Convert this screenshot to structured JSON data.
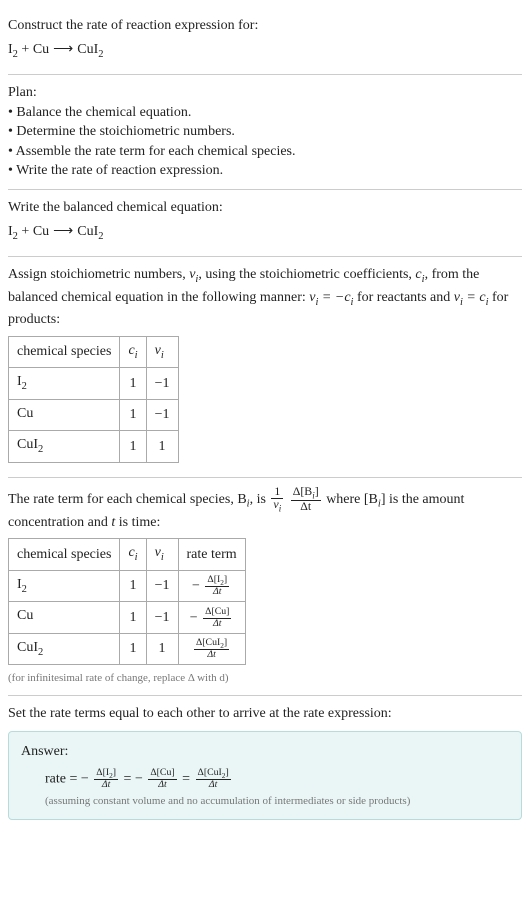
{
  "intro": {
    "prompt": "Construct the rate of reaction expression for:",
    "equation_parts": {
      "r1": "I",
      "r1sub": "2",
      "plus1": " + ",
      "r2": "Cu",
      "arrow": " ⟶ ",
      "p1": "CuI",
      "p1sub": "2"
    }
  },
  "plan": {
    "heading": "Plan:",
    "items": [
      "• Balance the chemical equation.",
      "• Determine the stoichiometric numbers.",
      "• Assemble the rate term for each chemical species.",
      "• Write the rate of reaction expression."
    ]
  },
  "balanced": {
    "heading": "Write the balanced chemical equation:",
    "equation_parts": {
      "r1": "I",
      "r1sub": "2",
      "plus1": " + ",
      "r2": "Cu",
      "arrow": " ⟶ ",
      "p1": "CuI",
      "p1sub": "2"
    }
  },
  "stoich": {
    "text": {
      "a": "Assign stoichiometric numbers, ",
      "nu_i": "ν",
      "nu_i_sub": "i",
      "b": ", using the stoichiometric coefficients, ",
      "c_i": "c",
      "c_i_sub": "i",
      "c": ", from the balanced chemical equation in the following manner: ",
      "eq1_l": "ν",
      "eq1_lsub": "i",
      "eq1_m": " = −c",
      "eq1_msub": "i",
      "d": " for reactants and ",
      "eq2_l": "ν",
      "eq2_lsub": "i",
      "eq2_m": " = c",
      "eq2_msub": "i",
      "e": " for products:"
    },
    "table": {
      "h1": "chemical species",
      "h2": "c",
      "h2sub": "i",
      "h3": "ν",
      "h3sub": "i",
      "rows": [
        {
          "sp": "I",
          "spsub": "2",
          "c": "1",
          "nu": "−1"
        },
        {
          "sp": "Cu",
          "spsub": "",
          "c": "1",
          "nu": "−1"
        },
        {
          "sp": "CuI",
          "spsub": "2",
          "c": "1",
          "nu": "1"
        }
      ]
    }
  },
  "rateterm": {
    "text": {
      "a": "The rate term for each chemical species, B",
      "a_sub": "i",
      "b": ", is ",
      "frac1_num": "1",
      "frac1_den": "ν",
      "frac1_den_sub": "i",
      "frac2_num": "Δ[B",
      "frac2_num_sub": "i",
      "frac2_num_end": "]",
      "frac2_den": "Δt",
      "c": " where [B",
      "c_sub": "i",
      "c_end": "] is the amount concentration and ",
      "t": "t",
      "d": " is time:"
    },
    "table": {
      "h1": "chemical species",
      "h2": "c",
      "h2sub": "i",
      "h3": "ν",
      "h3sub": "i",
      "h4": "rate term",
      "rows": [
        {
          "sp": "I",
          "spsub": "2",
          "c": "1",
          "nu": "−1",
          "sign": "−",
          "conc": "Δ[I",
          "concsub": "2",
          "concend": "]",
          "den": "Δt"
        },
        {
          "sp": "Cu",
          "spsub": "",
          "c": "1",
          "nu": "−1",
          "sign": "−",
          "conc": "Δ[Cu]",
          "concsub": "",
          "concend": "",
          "den": "Δt"
        },
        {
          "sp": "CuI",
          "spsub": "2",
          "c": "1",
          "nu": "1",
          "sign": "",
          "conc": "Δ[CuI",
          "concsub": "2",
          "concend": "]",
          "den": "Δt"
        }
      ]
    },
    "note": "(for infinitesimal rate of change, replace Δ with d)"
  },
  "final": {
    "heading": "Set the rate terms equal to each other to arrive at the rate expression:"
  },
  "answer": {
    "label": "Answer:",
    "rate": "rate = ",
    "t1": {
      "sign": "−",
      "num": "Δ[I",
      "numsub": "2",
      "numend": "]",
      "den": "Δt"
    },
    "eq1": " = ",
    "t2": {
      "sign": "−",
      "num": "Δ[Cu]",
      "numsub": "",
      "numend": "",
      "den": "Δt"
    },
    "eq2": " = ",
    "t3": {
      "sign": "",
      "num": "Δ[CuI",
      "numsub": "2",
      "numend": "]",
      "den": "Δt"
    },
    "note": "(assuming constant volume and no accumulation of intermediates or side products)"
  }
}
